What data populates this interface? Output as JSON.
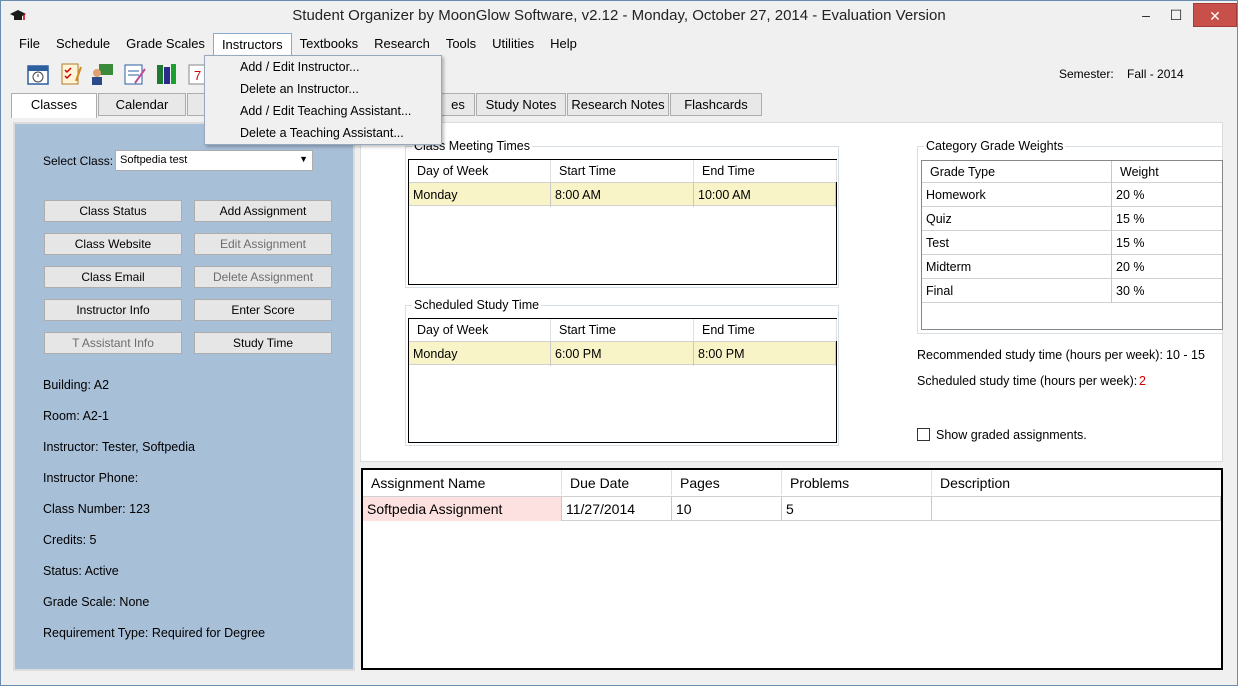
{
  "window": {
    "title": "Student Organizer by MoonGlow Software, v2.12  -  Monday, October 27, 2014  -  Evaluation Version",
    "min_glyph": "–",
    "max_glyph": "☐",
    "close_glyph": "✕"
  },
  "menu": [
    "File",
    "Schedule",
    "Grade Scales",
    "Instructors",
    "Textbooks",
    "Research",
    "Tools",
    "Utilities",
    "Help"
  ],
  "instructors_menu": [
    "Add / Edit Instructor...",
    "Delete an Instructor...",
    "Add / Edit Teaching Assistant...",
    "Delete a Teaching Assistant..."
  ],
  "toolbar_icons": [
    "calendar-icon",
    "checklist-icon",
    "instructor-icon",
    "notepad-icon",
    "books-icon",
    "date-icon"
  ],
  "semester": {
    "label": "Semester:",
    "value": "Fall - 2014"
  },
  "tabs": [
    "Classes",
    "Calendar",
    "es",
    "Study Notes",
    "Research Notes",
    "Flashcards"
  ],
  "left": {
    "select_label": "Select Class:",
    "select_value": "Softpedia test",
    "buttons": [
      {
        "label": "Class Status",
        "enabled": true
      },
      {
        "label": "Add Assignment",
        "enabled": true
      },
      {
        "label": "Class Website",
        "enabled": true
      },
      {
        "label": "Edit Assignment",
        "enabled": false
      },
      {
        "label": "Class Email",
        "enabled": true
      },
      {
        "label": "Delete Assignment",
        "enabled": false
      },
      {
        "label": "Instructor Info",
        "enabled": true
      },
      {
        "label": "Enter Score",
        "enabled": true
      },
      {
        "label": "T Assistant Info",
        "enabled": false
      },
      {
        "label": "Study Time",
        "enabled": true
      }
    ],
    "info": [
      "Building:  A2",
      "Room:  A2-1",
      "Instructor:  Tester,  Softpedia",
      "Instructor Phone:",
      "Class Number:  123",
      "Credits:  5",
      "Status:  Active",
      "Grade Scale:  None",
      "Requirement Type:  Required for Degree"
    ]
  },
  "meeting": {
    "title": "Class Meeting Times",
    "headers": [
      "Day of Week",
      "Start Time",
      "End Time"
    ],
    "row": [
      "Monday",
      "8:00 AM",
      "10:00 AM"
    ]
  },
  "study": {
    "title": "Scheduled Study Time",
    "headers": [
      "Day of Week",
      "Start Time",
      "End Time"
    ],
    "row": [
      "Monday",
      "6:00 PM",
      "8:00 PM"
    ]
  },
  "weights": {
    "title": "Category Grade Weights",
    "headers": [
      "Grade Type",
      "Weight"
    ],
    "rows": [
      [
        "Homework",
        "20 %"
      ],
      [
        "Quiz",
        "15 %"
      ],
      [
        "Test",
        "15 %"
      ],
      [
        "Midterm",
        "20 %"
      ],
      [
        "Final",
        "30 %"
      ]
    ]
  },
  "study_time": {
    "recommended_label": "Recommended study time (hours per week):",
    "recommended_value": "10 - 15",
    "scheduled_label": "Scheduled study time (hours per week):",
    "scheduled_value": "2",
    "scheduled_color": "#d00000"
  },
  "show_graded": "Show graded assignments.",
  "assignments": {
    "headers": [
      "Assignment Name",
      "Due Date",
      "Pages",
      "Problems",
      "Description"
    ],
    "rows": [
      [
        "Softpedia Assignment",
        "11/27/2014",
        "10",
        "5",
        ""
      ]
    ]
  },
  "colors": {
    "left_panel": "#a8bfd8",
    "row_highlight": "#f8f4c8",
    "selected_cell": "#fde0e0",
    "close_button": "#c7504a"
  }
}
